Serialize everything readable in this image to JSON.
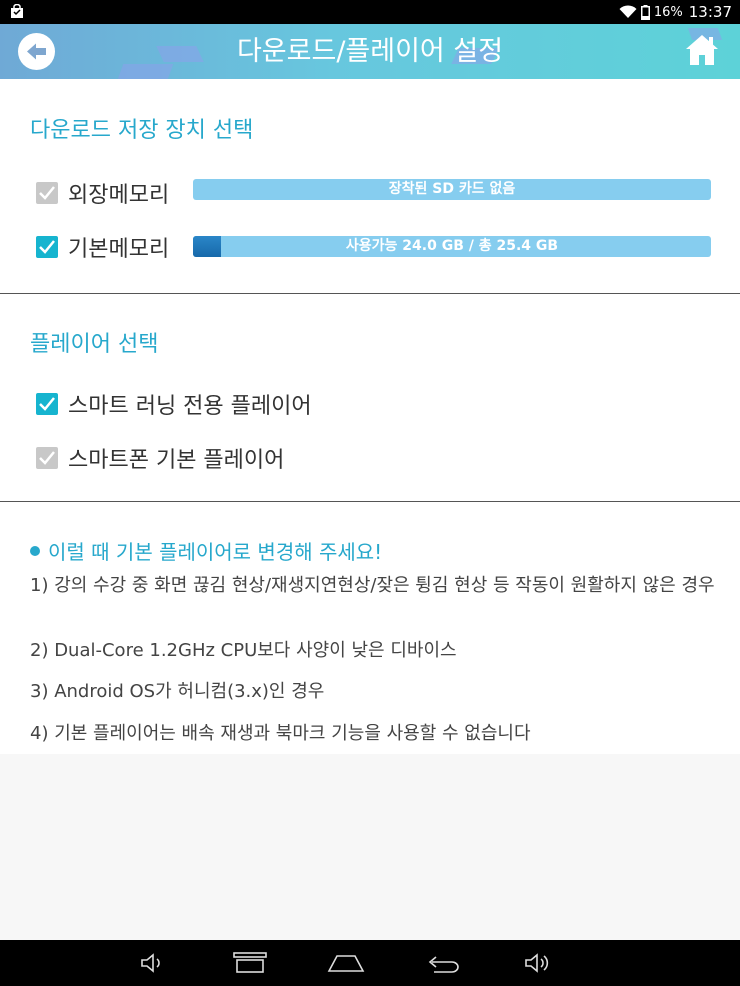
{
  "status_bar": {
    "battery": "16%",
    "time": "13:37",
    "icons": [
      "shopping-bag-icon",
      "wifi-icon",
      "battery-icon"
    ]
  },
  "app_bar": {
    "title": "다운로드/플레이어 설정",
    "icons": [
      "back-arrow-icon",
      "home-icon"
    ]
  },
  "storage_section": {
    "title": "다운로드 저장 장치 선택",
    "options": [
      {
        "label": "외장메모리",
        "checked": false,
        "bar_text": "장착된 SD 카드 없음",
        "used_fraction": 0
      },
      {
        "label": "기본메모리",
        "checked": true,
        "bar_text": "사용가능 24.0 GB / 총 25.4 GB",
        "used_fraction": 0.055
      }
    ]
  },
  "player_section": {
    "title": "플레이어 선택",
    "options": [
      {
        "label": "스마트 러닝 전용 플레이어",
        "checked": true
      },
      {
        "label": "스마트폰 기본 플레이어",
        "checked": false
      }
    ]
  },
  "notice": {
    "heading": "이럴 때 기본 플레이어로 변경해 주세요!",
    "items": [
      "1) 강의 수강 중 화면 끊김 현상/재생지연현상/잦은 튕김 현상 등 작동이 원활하지 않은 경우",
      "2) Dual-Core 1.2GHz CPU보다 사양이 낮은 디바이스",
      "3) Android OS가 허니컴(3.x)인 경우",
      "4) 기본 플레이어는 배속 재생과 북마크 기능을 사용할 수 없습니다"
    ]
  },
  "nav_bar": {
    "icons": [
      "volume-down-icon",
      "recent-apps-icon",
      "home-nav-icon",
      "back-nav-icon",
      "volume-up-icon"
    ]
  },
  "colors": {
    "accent": "#27a8cc",
    "checkbox_on": "#16b4cf",
    "checkbox_off": "#c8c8c8",
    "bar_bg": "#86cdef",
    "bar_fill": "#1769aa"
  }
}
